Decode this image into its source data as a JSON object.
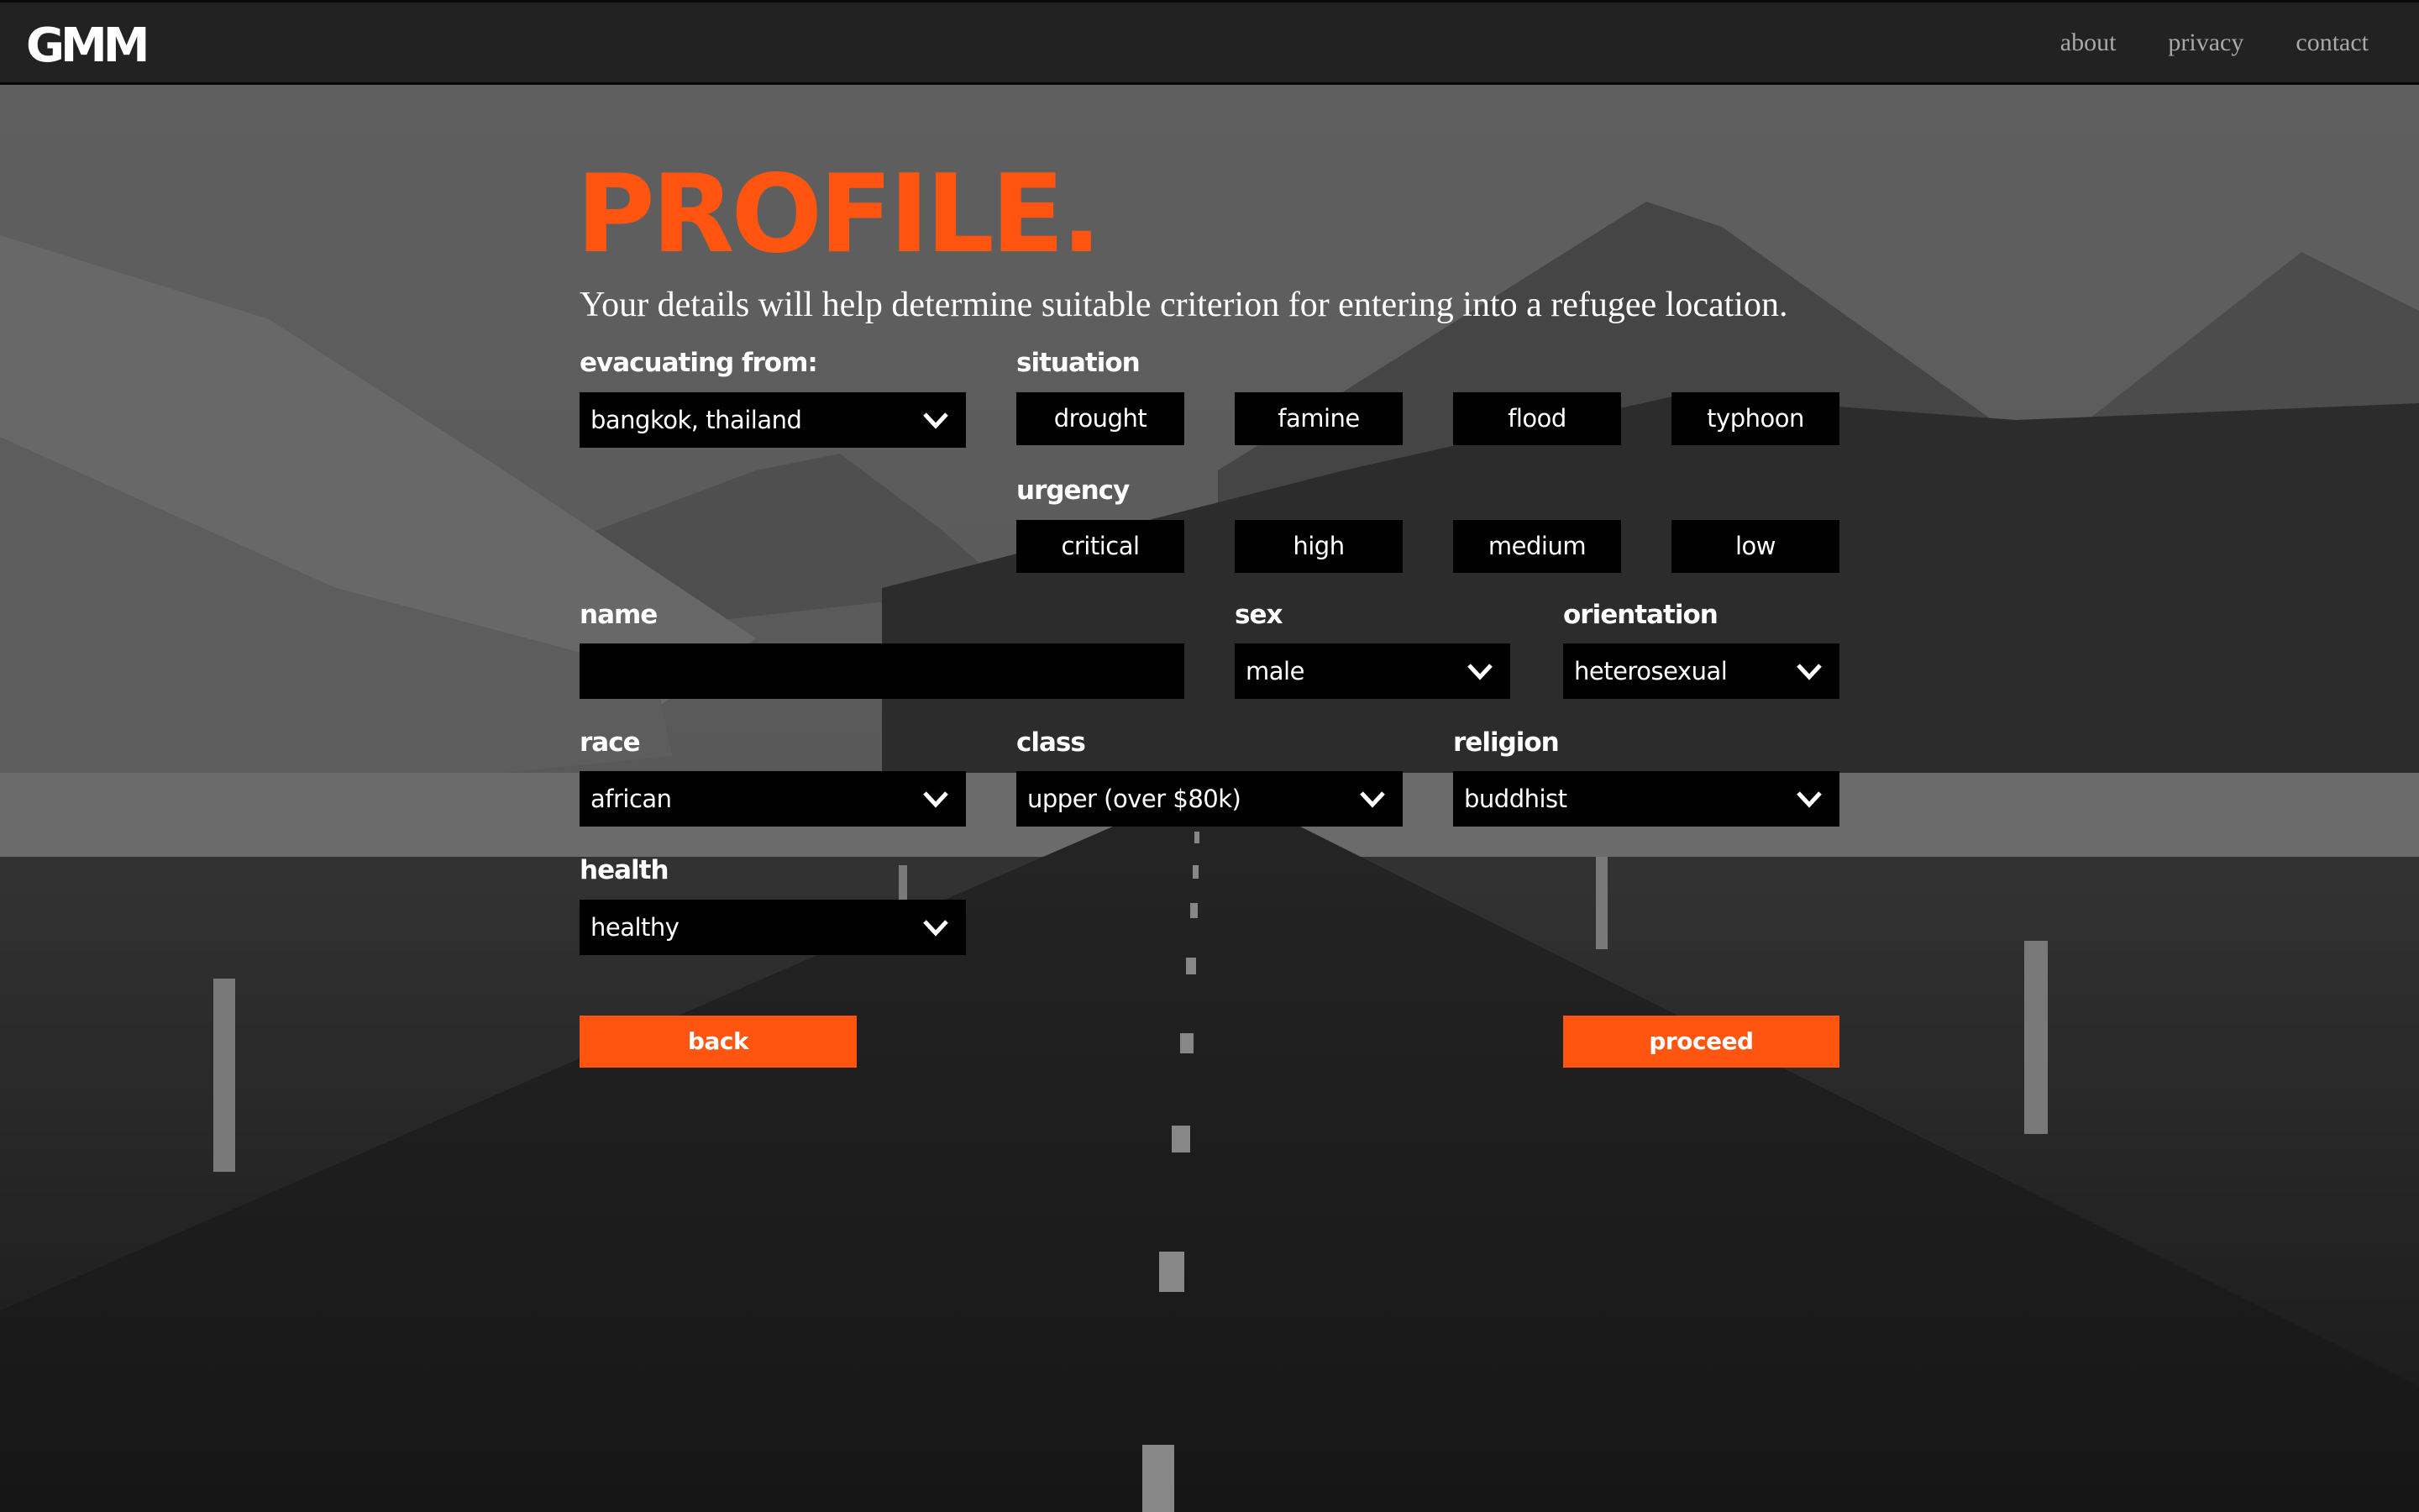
{
  "nav": {
    "logo": "GMM",
    "links": [
      "about",
      "privacy",
      "contact"
    ]
  },
  "page": {
    "title": "PROFILE.",
    "subtitle": "Your details will help determine suitable criterion for entering into a refugee location."
  },
  "form": {
    "evacuating_from": {
      "label": "evacuating from:",
      "value": "bangkok, thailand"
    },
    "situation": {
      "label": "situation",
      "options": [
        "drought",
        "famine",
        "flood",
        "typhoon"
      ]
    },
    "urgency": {
      "label": "urgency",
      "options": [
        "critical",
        "high",
        "medium",
        "low"
      ]
    },
    "name": {
      "label": "name",
      "value": "",
      "placeholder": ""
    },
    "sex": {
      "label": "sex",
      "value": "male"
    },
    "orientation": {
      "label": "orientation",
      "value": "heterosexual"
    },
    "race": {
      "label": "race",
      "value": "african"
    },
    "class": {
      "label": "class",
      "value": "upper (over $80k)"
    },
    "religion": {
      "label": "religion",
      "value": "buddhist"
    },
    "health": {
      "label": "health",
      "value": "healthy"
    }
  },
  "actions": {
    "back": "back",
    "proceed": "proceed"
  },
  "colors": {
    "accent": "#ff5511",
    "nav_bg": "#222222",
    "field_bg": "#000000"
  }
}
